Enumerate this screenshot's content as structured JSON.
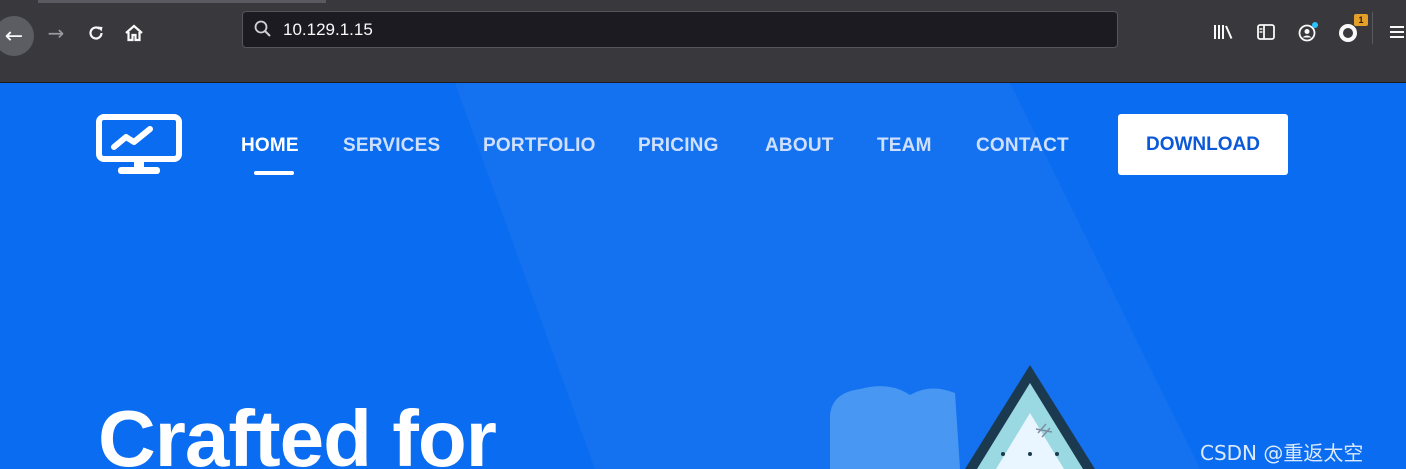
{
  "browser": {
    "url": "10.129.1.15",
    "extension_badge": "1"
  },
  "site": {
    "nav": [
      "HOME",
      "SERVICES",
      "PORTFOLIO",
      "PRICING",
      "ABOUT",
      "TEAM",
      "CONTACT"
    ],
    "download_label": "DOWNLOAD",
    "hero_title": "Crafted for"
  },
  "watermark": "CSDN @重返太空",
  "colors": {
    "page_bg": "#0a6cf0",
    "chrome_bg": "#38383d",
    "download_text": "#0b59d8"
  }
}
